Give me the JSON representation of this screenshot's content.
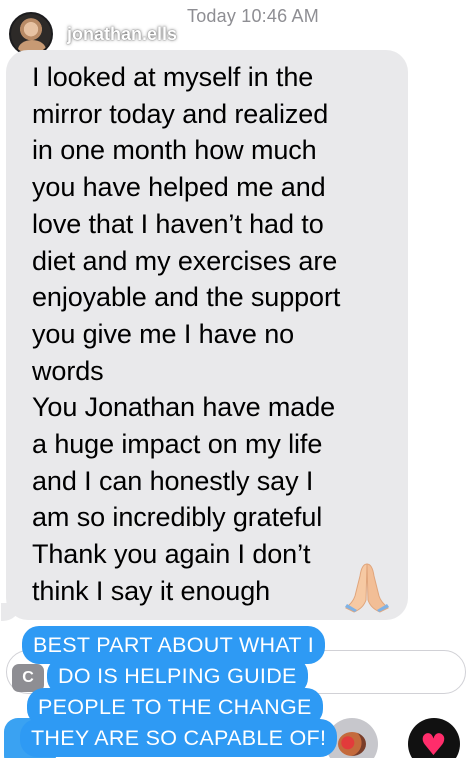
{
  "header": {
    "timestamp": "Today 10:46 AM",
    "username": "jonathan.ells"
  },
  "message": {
    "lines": [
      "I looked at myself in the",
      "mirror today and realized",
      "in one month how much",
      "you have helped me and",
      "love that I haven’t had to",
      "diet and my exercises are",
      "enjoyable and the support",
      "you give me I have no",
      "words",
      "You Jonathan have made",
      "a huge impact on my life",
      "and I can honestly say I",
      "am so incredibly grateful",
      "Thank you again I don’t",
      "think I say it enough"
    ],
    "emoji": "praying-hands-emoji"
  },
  "caption": {
    "lines": [
      "BEST PART ABOUT WHAT I",
      "DO IS HELPING GUIDE",
      "PEOPLE TO THE CHANGE",
      "THEY ARE SO CAPABLE OF!"
    ],
    "color": "#2e9af4"
  },
  "input_bar": {
    "camera_icon": "camera-icon"
  },
  "colors": {
    "bubble": "#e9e9eb",
    "timestamp": "#8e8e93",
    "caption_background": "#2e9af4"
  }
}
